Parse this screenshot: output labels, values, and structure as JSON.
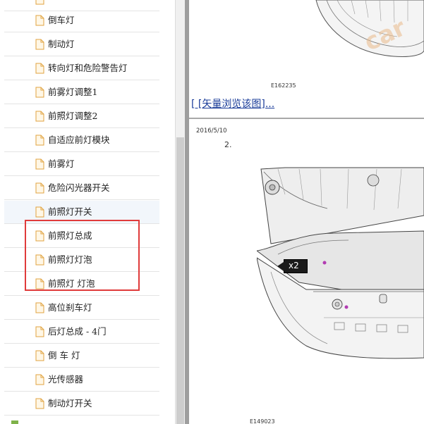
{
  "sidebar": {
    "items": [
      {
        "label": "倒车灯"
      },
      {
        "label": "制动灯"
      },
      {
        "label": "转向灯和危险警告灯"
      },
      {
        "label": "前雾灯调整1"
      },
      {
        "label": "前照灯调整2"
      },
      {
        "label": "自适应前灯模块"
      },
      {
        "label": "前雾灯"
      },
      {
        "label": "危险闪光器开关"
      },
      {
        "label": "前照灯开关"
      },
      {
        "label": "前照灯总成"
      },
      {
        "label": "前照灯灯泡"
      },
      {
        "label": "前照灯 灯泡"
      },
      {
        "label": "高位刹车灯"
      },
      {
        "label": "后灯总成 - 4门"
      },
      {
        "label": "倒 车 灯"
      },
      {
        "label": "光传感器"
      },
      {
        "label": "制动灯开关"
      }
    ]
  },
  "content": {
    "figure1_id": "E162235",
    "vector_link": "[ [矢量浏览该图]...",
    "date": "2016/5/10",
    "step": "2.",
    "callout": "x2",
    "figure2_id": "E149023",
    "watermark": "car"
  },
  "colors": {
    "highlight": "#e03b3b",
    "link": "#1a3c99",
    "selected_bg": "#f2f6fb"
  }
}
